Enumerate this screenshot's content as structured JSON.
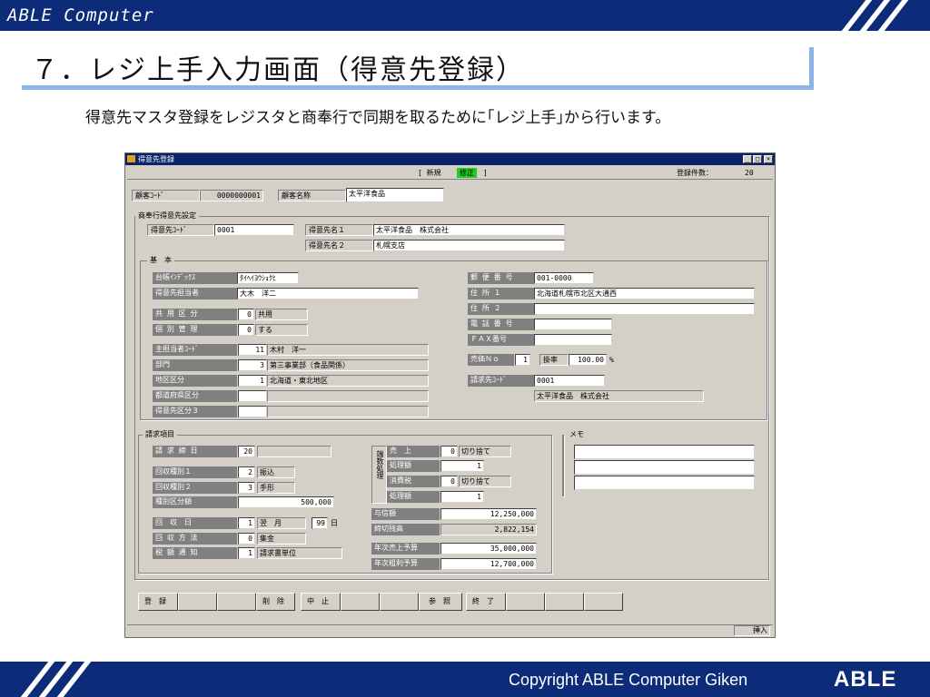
{
  "header": {
    "brand": "ABLE Computer"
  },
  "title": "７．レジ上手入力画面（得意先登録）",
  "description": "得意先マスタ登録をレジスタと商奉行で同期を取るために｢レジ上手｣から行います。",
  "footer": {
    "copyright": "Copyright ABLE Computer Giken",
    "logo": "ABLE"
  },
  "window": {
    "title": "得意先登録",
    "mode_open": "[ 新規",
    "mode_active": "修正",
    "mode_close": "]",
    "count_label": "登録件数：",
    "count_value": "20",
    "customer_code_label": "顧客ｺｰﾄﾞ",
    "customer_code": "0000000001",
    "customer_name_label": "顧客名称",
    "customer_name": "太平洋食品",
    "shobugyo": {
      "group_title": "商奉行得意先設定",
      "code_label": "得意先ｺｰﾄﾞ",
      "code": "0001",
      "name1_label": "得意先名１",
      "name1": "太平洋食品　株式会社",
      "name2_label": "得意先名２",
      "name2": "札幌支店"
    },
    "basic": {
      "group_title": "基　本",
      "ledger_index_label": "台帳ｲﾝﾃﾞｯｸｽ",
      "ledger_index": "ﾀｲﾍｲﾖｳｼｮｸﾋ",
      "contact_label": "得意先担当者",
      "contact": "大木　洋二",
      "shared_label": "共 用 区 分",
      "shared_code": "0",
      "shared_name": "共用",
      "individual_label": "個 別 管 理",
      "individual_code": "0",
      "individual_name": "する",
      "rep_label": "主担当者ｺｰﾄﾞ",
      "rep_code": "11",
      "rep_name": "木村　洋一",
      "dept_label": "部門",
      "dept_code": "3",
      "dept_name": "第三事業部（食品関係）",
      "area_label": "地区区分",
      "area_code": "1",
      "area_name": "北海道・東北地区",
      "pref_label": "都道府県区分",
      "pref_code": "",
      "pref_name": "",
      "cat3_label": "得意先区分３",
      "cat3_code": "",
      "cat3_name": "",
      "zip_label": "郵 便 番 号",
      "zip": "001-0000",
      "addr1_label": "住 所 １",
      "addr1": "北海道札幌市北区大通西",
      "addr2_label": "住 所 ２",
      "addr2": "",
      "tel_label": "電 話 番 号",
      "tel": "",
      "fax_label": "ＦＡＸ番号",
      "fax": "",
      "price_no_label": "売価Ｎｏ",
      "price_no": "1",
      "rate_label": "掛率",
      "rate": "100.00",
      "rate_unit": "%",
      "bill_code_label": "請求先ｺｰﾄﾞ",
      "bill_code": "0001",
      "bill_name": "太平洋食品　株式会社"
    },
    "billing": {
      "group_title": "請求項目",
      "close_day_label": "請 求 締 日",
      "close_day": "20",
      "close_day_name": "",
      "collect1_label": "回収種別１",
      "collect1_code": "2",
      "collect1_name": "振込",
      "collect2_label": "回収種別２",
      "collect2_code": "3",
      "collect2_name": "手形",
      "collect_amount_label": "種別区分額",
      "collect_amount": "500,000",
      "collect_day_label": "回　収　日",
      "collect_day_code": "1",
      "collect_day_month": "翌　月",
      "collect_day_day": "99",
      "collect_day_unit": "日",
      "collect_method_label": "回 収 方 法",
      "collect_method_code": "0",
      "collect_method_name": "集金",
      "tax_notice_label": "税 額 通 知",
      "tax_notice_code": "1",
      "tax_notice_name": "請求書単位",
      "fraction_vertical": "端数処理",
      "sales_label": "売　上",
      "sales_code": "0",
      "sales_name": "切り捨て",
      "process1_label": "処理額",
      "process1": "1",
      "tax_label": "消費税",
      "tax_code": "0",
      "tax_name": "切り捨て",
      "process2_label": "処理額",
      "process2": "1",
      "credit_label": "与信額",
      "credit": "12,250,000",
      "balance_label": "締切残高",
      "balance": "2,822,154",
      "annual_sales_label": "年次売上予算",
      "annual_sales": "35,000,000",
      "annual_profit_label": "年次粗利予算",
      "annual_profit": "12,700,000"
    },
    "memo": {
      "group_title": "メモ",
      "lines": [
        "",
        "",
        ""
      ]
    },
    "buttons": {
      "register": "登　録",
      "delete": "削　除",
      "cancel": "中　止",
      "reference": "参　照",
      "exit": "終　了"
    },
    "status": {
      "insert": "挿入"
    }
  }
}
